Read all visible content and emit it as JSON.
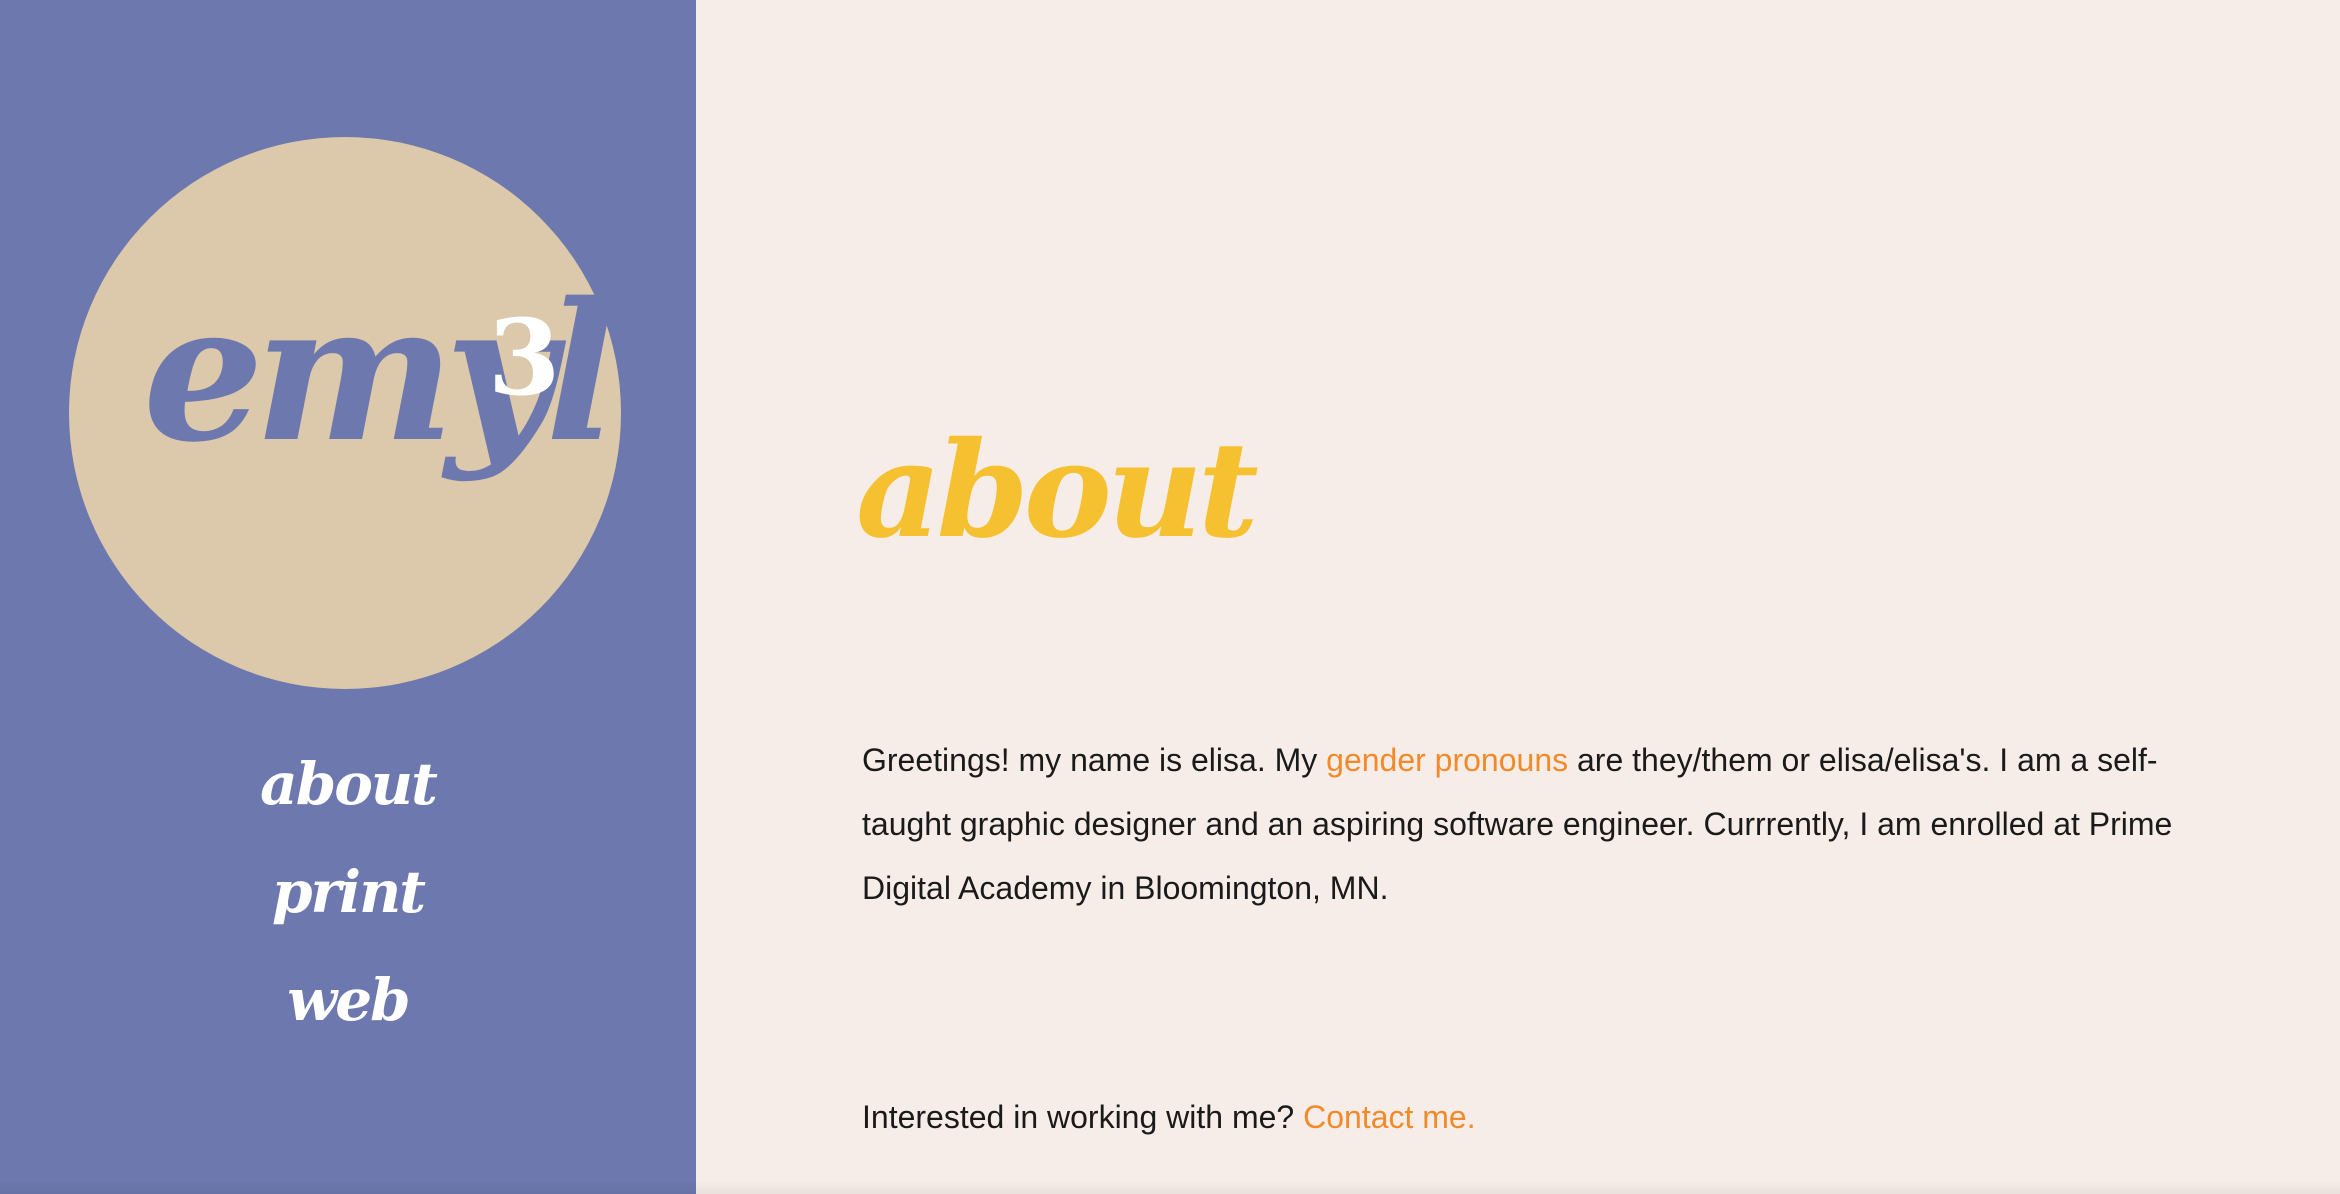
{
  "colors": {
    "sidebar": "#6c78ae",
    "logo_circle": "#dcc8aa",
    "page_background": "#f7ede8",
    "title": "#f5c131",
    "link": "#f28a2a",
    "text": "#1a1a1a"
  },
  "logo": {
    "wordmark": "emyl",
    "superscript": "3"
  },
  "nav": {
    "items": [
      {
        "label": "about"
      },
      {
        "label": "print"
      },
      {
        "label": "web"
      }
    ]
  },
  "main": {
    "title": "about",
    "intro": {
      "part1": "Greetings! my name is elisa. My ",
      "link": "gender pronouns",
      "part2": " are they/them or elisa/elisa's. I am a self-taught graphic designer and an aspiring software engineer. Currrently, I am enrolled at Prime Digital Academy in Bloomington, MN."
    },
    "cta": {
      "text": "Interested in working with me? ",
      "link": "Contact me."
    }
  }
}
